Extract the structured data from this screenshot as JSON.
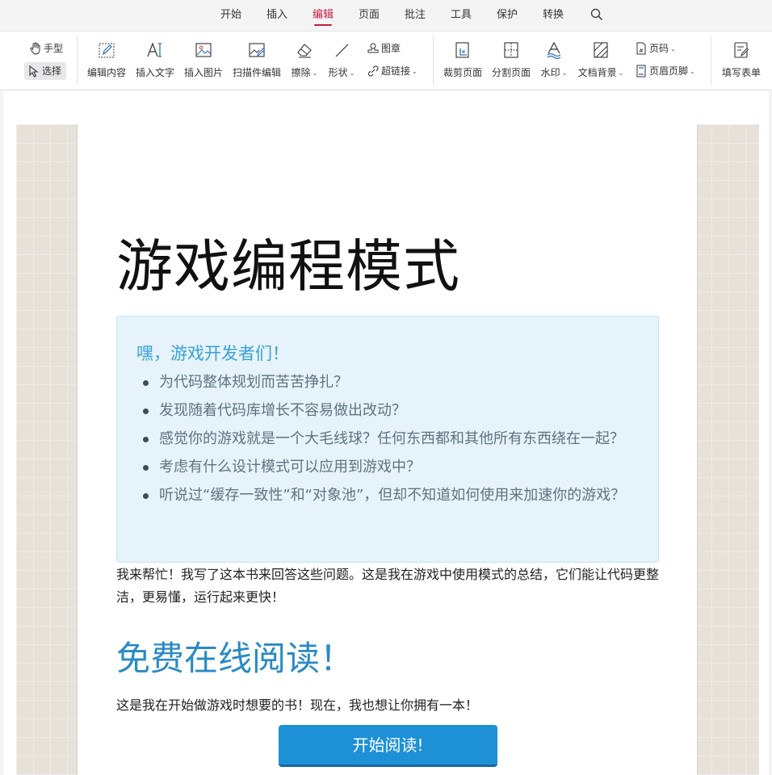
{
  "menu": {
    "tabs": [
      {
        "label": "开始"
      },
      {
        "label": "插入"
      },
      {
        "label": "编辑"
      },
      {
        "label": "页面"
      },
      {
        "label": "批注"
      },
      {
        "label": "工具"
      },
      {
        "label": "保护"
      },
      {
        "label": "转换"
      }
    ],
    "active_tab": "编辑",
    "active_color": "#c9193e"
  },
  "ribbon": {
    "hand_tool": "手型",
    "select_tool": "选择",
    "edit_content": "编辑内容",
    "insert_text": "插入文字",
    "insert_image": "插入图片",
    "scan_edit": "扫描件编辑",
    "erase": "擦除",
    "shape": "形状",
    "stamp": "图章",
    "hyperlink": "超链接",
    "crop_page": "裁剪页面",
    "split_page": "分割页面",
    "watermark": "水印",
    "doc_background": "文档背景",
    "page_number": "页码",
    "header_footer": "页眉页脚",
    "fill_form": "填写表单"
  },
  "document": {
    "title": "游戏编程模式",
    "callout": {
      "heading": "嘿，游戏开发者们！",
      "items": [
        "为代码整体规划而苦苦挣扎？",
        "发现随着代码库增长不容易做出改动？",
        "感觉你的游戏就是一个大毛线球？任何东西都和其他所有东西绕在一起？",
        "考虑有什么设计模式可以应用到游戏中？",
        "听说过“缓存一致性”和“对象池”，但却不知道如何使用来加速你的游戏？"
      ]
    },
    "intro": "我来帮忙！我写了这本书来回答这些问题。这是我在游戏中使用模式的总结，它们能让代码更整洁，更易懂，运行起来更快！",
    "read_heading": "免费在线阅读！",
    "read_text": "这是我在开始做游戏时想要的书！现在，我也想让你拥有一本！",
    "cta_label": "开始阅读!"
  }
}
